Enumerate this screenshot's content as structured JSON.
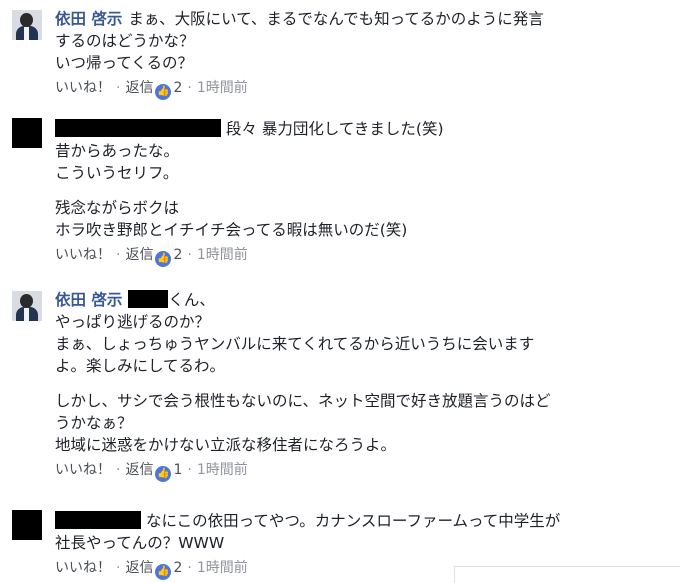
{
  "comments": [
    {
      "author": "依田 啓示",
      "lines": [
        "まぁ、大阪にいて、まるでなんでも知ってるかのように発言",
        "するのはどうかな？",
        "いつ帰ってくるの？"
      ],
      "actions": {
        "like": "いいね！",
        "reply": "返信",
        "like_count": "2",
        "time": "1時間前"
      }
    },
    {
      "author": "",
      "first_line_suffix": "段々 暴力団化してきました(笑)",
      "lines": [
        "昔からあったな。",
        "こういうセリフ。"
      ],
      "lines2": [
        "残念ながらボクは",
        "ホラ吹き野郎とイチイチ会ってる暇は無いのだ(笑)"
      ],
      "actions": {
        "like": "いいね！",
        "reply": "返信",
        "like_count": "2",
        "time": "1時間前"
      }
    },
    {
      "author": "依田 啓示",
      "first_line_suffix": "くん、",
      "lines": [
        "やっぱり逃げるのか？",
        "まぁ、しょっちゅうヤンバルに来てくれてるから近いうちに会います",
        "よ。楽しみにしてるわ。"
      ],
      "lines2": [
        "しかし、サシで会う根性もないのに、ネット空間で好き放題言うのはど",
        "うかなぁ？",
        "地域に迷惑をかけない立派な移住者になろうよ。"
      ],
      "actions": {
        "like": "いいね！",
        "reply": "返信",
        "like_count": "1",
        "time": "1時間前"
      }
    },
    {
      "author": "",
      "first_line_suffix": "なにこの依田ってやつ。カナンスローファームって中学生が",
      "lines": [
        "社長やってんの？WWW"
      ],
      "actions": {
        "like": "いいね！",
        "reply": "返信",
        "like_count": "2",
        "time": "1時間前"
      }
    }
  ],
  "colors": {
    "name": "#385898",
    "like_icon": "#4a78d8",
    "meta": "#90949c"
  },
  "icons": {
    "like": "thumbs-up-icon"
  }
}
